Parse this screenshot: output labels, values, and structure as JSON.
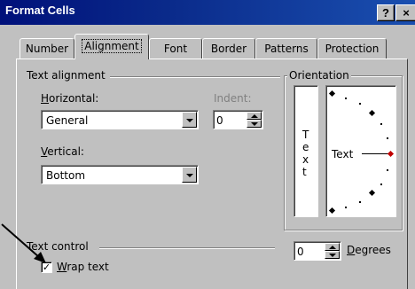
{
  "window": {
    "title": "Format Cells",
    "help_label": "?",
    "close_label": "×"
  },
  "tabs": [
    {
      "label": "Number",
      "active": false
    },
    {
      "label": "Alignment",
      "active": true
    },
    {
      "label": "Font",
      "active": false
    },
    {
      "label": "Border",
      "active": false
    },
    {
      "label": "Patterns",
      "active": false
    },
    {
      "label": "Protection",
      "active": false
    }
  ],
  "text_alignment": {
    "group_label": "Text alignment",
    "horizontal_label_mnemonic": "H",
    "horizontal_label_rest": "orizontal:",
    "horizontal_value": "General",
    "indent_label": "Indent:",
    "indent_value": "0",
    "vertical_label_mnemonic": "V",
    "vertical_label_rest": "ertical:",
    "vertical_value": "Bottom"
  },
  "orientation": {
    "group_label": "Orientation",
    "vertical_text": [
      "T",
      "e",
      "x",
      "t"
    ],
    "dial_text": "Text",
    "degrees_value": "0",
    "degrees_label_mnemonic": "D",
    "degrees_label_rest": "egrees",
    "marker_color": "#c00000"
  },
  "text_control": {
    "group_label": "Text control",
    "wrap_mnemonic": "W",
    "wrap_rest": "rap text",
    "wrap_checked": true,
    "check_glyph": "✓"
  },
  "annotation": {
    "arrow_color": "#000000"
  }
}
